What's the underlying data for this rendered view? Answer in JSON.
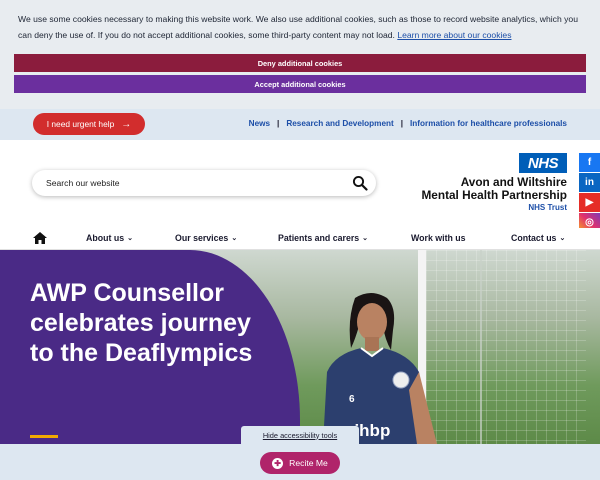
{
  "cookie": {
    "text": "We use some cookies necessary to making this website work. We also use additional cookies, such as those to record website analytics, which you can deny the use of. If you do not accept additional cookies, some third-party content may not load.",
    "learn_more": "Learn more about our cookies",
    "deny_label": "Deny additional cookies",
    "accept_label": "Accept additional cookies"
  },
  "utility": {
    "urgent_label": "I need urgent help",
    "urgent_icon": "arrow-right-icon",
    "links": [
      {
        "label": "News"
      },
      {
        "label": "Research and Development"
      },
      {
        "label": "Information for healthcare professionals"
      }
    ],
    "separator": "|"
  },
  "header": {
    "search_placeholder": "Search our website",
    "nhs_badge": "NHS",
    "org_line1": "Avon and Wiltshire",
    "org_line2": "Mental Health Partnership",
    "org_sub": "NHS Trust"
  },
  "social": [
    {
      "icon": "facebook-icon",
      "glyph": "f"
    },
    {
      "icon": "linkedin-icon",
      "glyph": "in"
    },
    {
      "icon": "youtube-icon",
      "glyph": "▶"
    },
    {
      "icon": "instagram-icon",
      "glyph": "◎"
    }
  ],
  "nav": {
    "home_icon": "home-icon",
    "items": [
      {
        "label": "About us",
        "dropdown": true
      },
      {
        "label": "Our services",
        "dropdown": true
      },
      {
        "label": "Patients and carers",
        "dropdown": true
      },
      {
        "label": "Work with us",
        "dropdown": false
      },
      {
        "label": "Contact us",
        "dropdown": true
      }
    ]
  },
  "hero": {
    "title": "AWP Counsellor celebrates journey to the Deaflympics",
    "shirt_number": "6",
    "shirt_text": "aihbp"
  },
  "accessibility": {
    "hide_label": "Hide accessibility tools",
    "recite_label": "Recite Me"
  },
  "colors": {
    "purple": "#4a2a86",
    "deny": "#8b1c3d",
    "accept": "#6b2f9e",
    "urgent": "#d22d2d",
    "nhs_blue": "#005eb8",
    "recite": "#b0246a"
  }
}
